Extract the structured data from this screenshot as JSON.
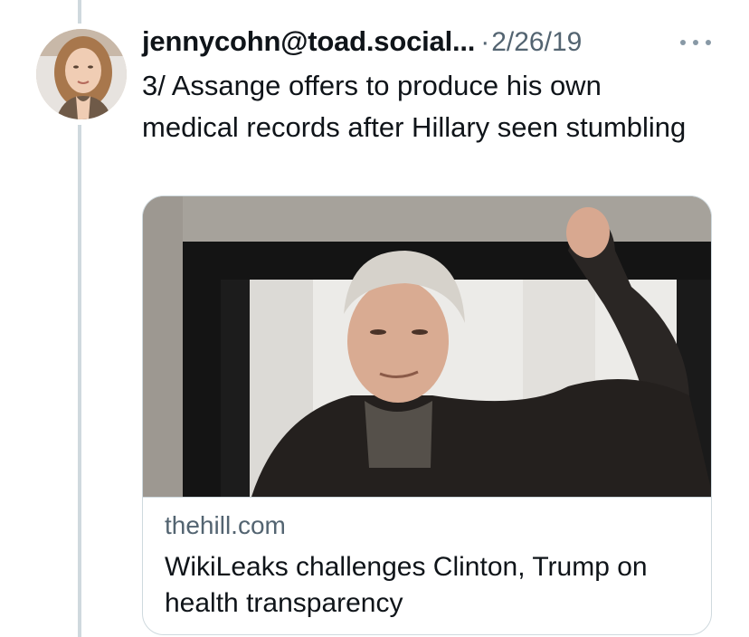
{
  "tweet": {
    "handle": "jennycohn@toad.social...",
    "separator": "·",
    "date": "2/26/19",
    "text": "3/ Assange offers to produce his own medical records after Hillary seen stumbling"
  },
  "card": {
    "domain": "thehill.com",
    "title": "WikiLeaks challenges Clinton, Trump on health transparency"
  },
  "icons": {
    "more": "more-horizontal-icon"
  },
  "colors": {
    "text_primary": "#0f1419",
    "text_secondary": "#536471",
    "border": "#cfd9de",
    "thread_line": "#cfd9de"
  }
}
